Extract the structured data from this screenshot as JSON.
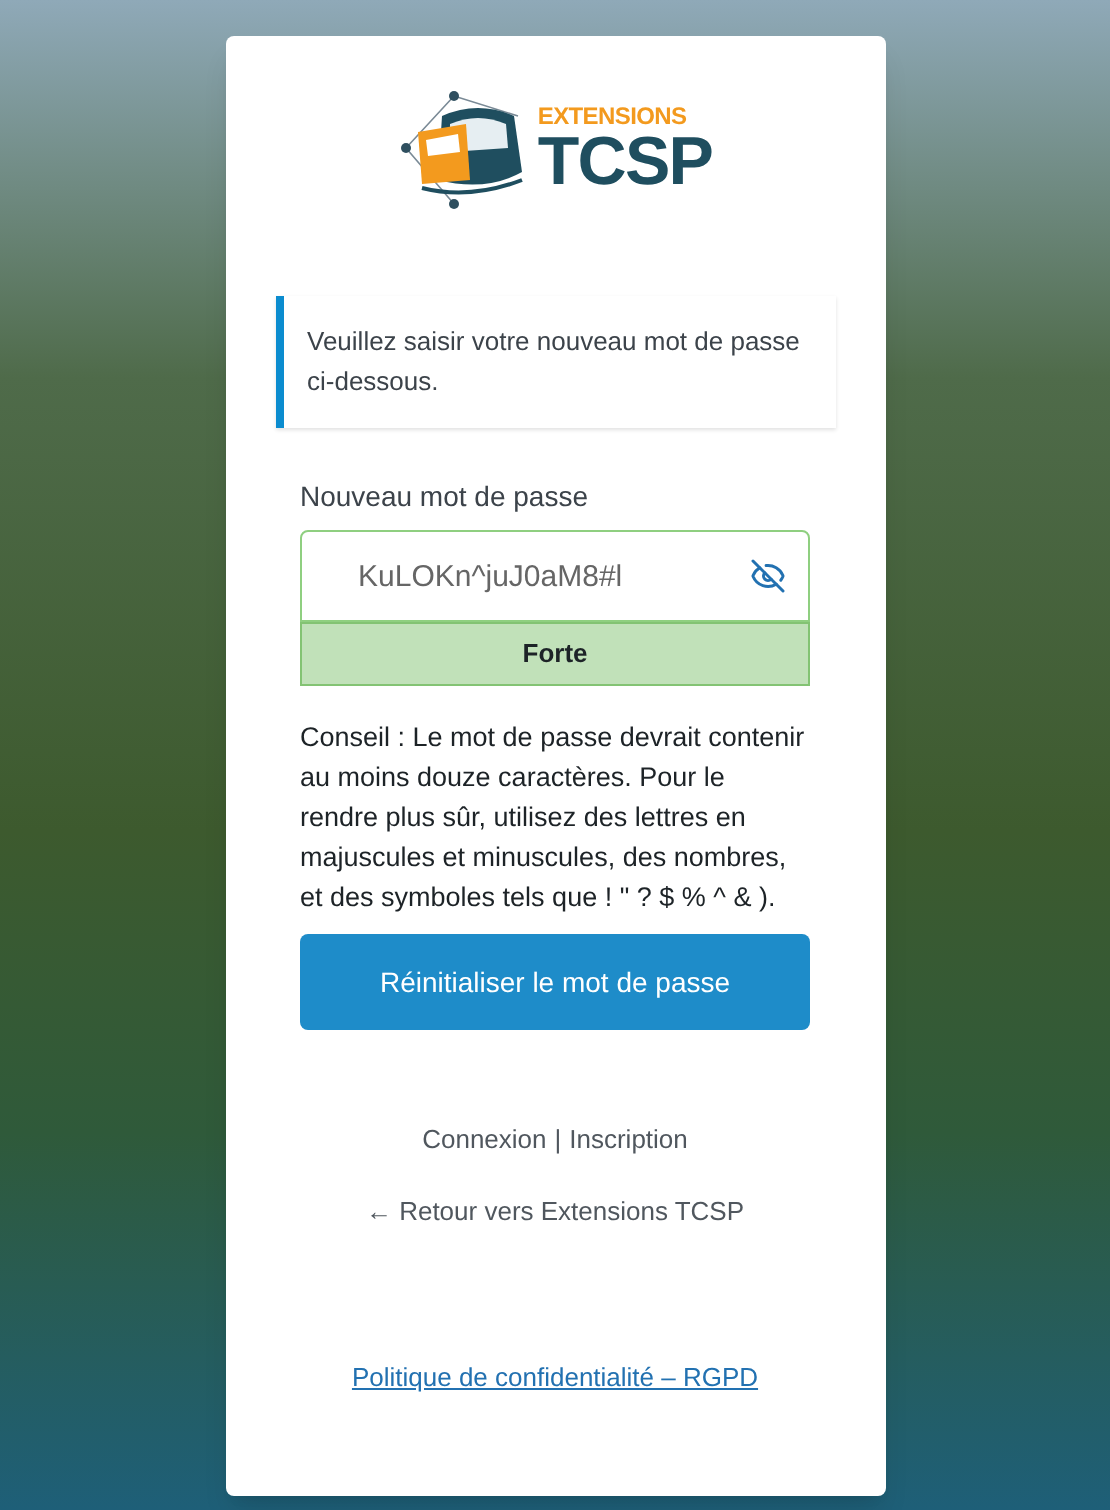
{
  "logo": {
    "line_1": "EXTENSIONS",
    "line_2": "TCSP"
  },
  "notice": "Veuillez saisir votre nouveau mot de passe ci-dessous.",
  "password": {
    "label": "Nouveau mot de passe",
    "value": "KuLOKn^juJ0aM8#l",
    "visible": true
  },
  "strength": {
    "label": "Forte",
    "kind": "strong"
  },
  "hint": "Conseil : Le mot de passe devrait contenir au moins douze caractères. Pour le rendre plus sûr, utilisez des lettres en majuscules et minuscules, des nombres, et des symboles tels que ! \" ? $ % ^ & ).",
  "submit": "Réinitialiser le mot de passe",
  "nav": {
    "links": [
      "Connexion",
      "Inscription"
    ],
    "separator": "|"
  },
  "back_link": "← Retour vers Extensions TCSP",
  "privacy_link": "Politique de confidentialité – RGPD"
}
